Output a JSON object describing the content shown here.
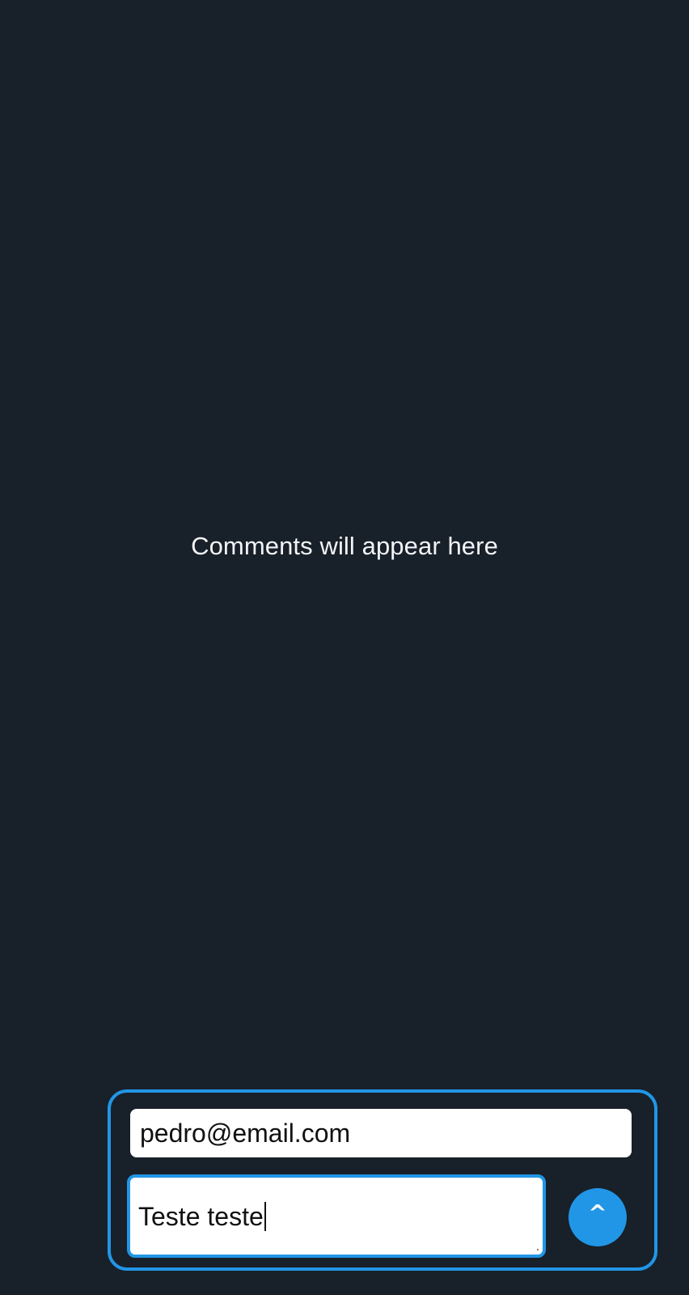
{
  "comments": {
    "empty_text": "Comments will appear here"
  },
  "composer": {
    "email_value": "pedro@email.com",
    "comment_value": "Teste teste",
    "send_glyph": "^",
    "send_icon": "caret-up-icon"
  },
  "colors": {
    "background": "#18202a",
    "accent": "#2196e6",
    "input_bg": "#ffffff",
    "text": "#f2f4f6"
  }
}
